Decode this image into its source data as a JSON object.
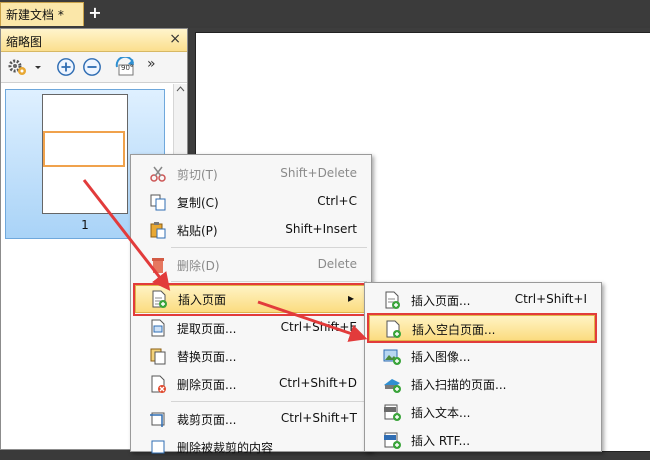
{
  "tab": {
    "title": "新建文档 *",
    "add_symbol": "+"
  },
  "thumbnail_panel": {
    "title": "缩略图",
    "close_symbol": "×",
    "rotate_label": "90°",
    "more_symbol": "»",
    "page_number": "1"
  },
  "context_menu": {
    "items": [
      {
        "label": "剪切(T)",
        "shortcut": "Shift+Delete"
      },
      {
        "label": "复制(C)",
        "shortcut": "Ctrl+C"
      },
      {
        "label": "粘贴(P)",
        "shortcut": "Shift+Insert"
      },
      {
        "label": "删除(D)",
        "shortcut": "Delete"
      },
      {
        "label": "插入页面",
        "shortcut": "▸"
      },
      {
        "label": "提取页面...",
        "shortcut": "Ctrl+Shift+E"
      },
      {
        "label": "替换页面...",
        "shortcut": ""
      },
      {
        "label": "删除页面...",
        "shortcut": "Ctrl+Shift+D"
      },
      {
        "label": "裁剪页面...",
        "shortcut": "Ctrl+Shift+T"
      },
      {
        "label": "删除被裁剪的内容",
        "shortcut": ""
      }
    ]
  },
  "submenu": {
    "items": [
      {
        "label": "插入页面...",
        "shortcut": "Ctrl+Shift+I"
      },
      {
        "label": "插入空白页面...",
        "shortcut": ""
      },
      {
        "label": "插入图像...",
        "shortcut": ""
      },
      {
        "label": "插入扫描的页面...",
        "shortcut": ""
      },
      {
        "label": "插入文本...",
        "shortcut": ""
      },
      {
        "label": "插入 RTF...",
        "shortcut": ""
      }
    ]
  },
  "colors": {
    "highlight": "#fbdc80",
    "annotation_red": "#e23b3b",
    "thumb_selection": "#f0a24c"
  }
}
